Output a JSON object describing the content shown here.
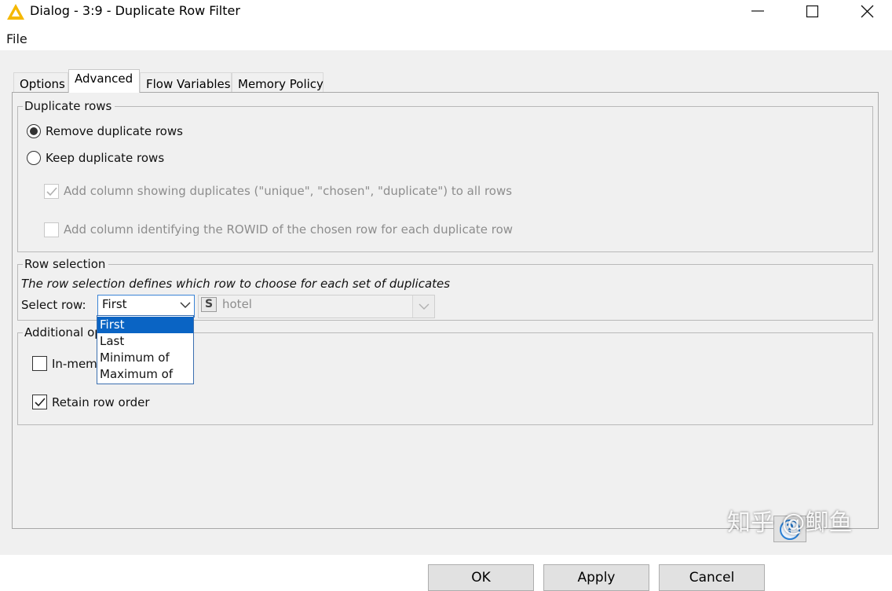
{
  "window": {
    "title": "Dialog - 3:9 - Duplicate Row Filter",
    "icons": {
      "app": "warning-triangle-icon",
      "minimize": "minimize-icon",
      "maximize": "maximize-icon",
      "close": "close-icon"
    }
  },
  "menu": {
    "file": "File"
  },
  "tabs": [
    {
      "label": "Options",
      "active": false
    },
    {
      "label": "Advanced",
      "active": true
    },
    {
      "label": "Flow Variables",
      "active": false
    },
    {
      "label": "Memory Policy",
      "active": false
    }
  ],
  "duplicate_rows": {
    "title": "Duplicate rows",
    "remove_label": "Remove duplicate rows",
    "remove_checked": true,
    "keep_label": "Keep duplicate rows",
    "keep_checked": false,
    "add_column_label": "Add column showing duplicates (\"unique\", \"chosen\", \"duplicate\") to all rows",
    "add_column_checked": true,
    "add_rowid_label": "Add column identifying the ROWID of the chosen row for each duplicate row",
    "add_rowid_checked": false
  },
  "row_selection": {
    "title": "Row selection",
    "description": "The row selection defines which row to choose for each set of duplicates",
    "select_label": "Select row:",
    "select_value": "First",
    "column_type_badge": "S",
    "column_value": "hotel",
    "options": [
      "First",
      "Last",
      "Minimum of",
      "Maximum of"
    ]
  },
  "additional_options": {
    "title": "Additional op",
    "in_memory_label": "In-memo",
    "in_memory_checked": false,
    "retain_order_label": "Retain row order",
    "retain_order_checked": true
  },
  "buttons": {
    "ok": "OK",
    "apply": "Apply",
    "cancel": "Cancel",
    "help": "?"
  },
  "watermark": "知乎 @鲫鱼",
  "colors": {
    "accent": "#0a64c4",
    "focus_border": "#3b84d6",
    "app_icon": "#f5b800",
    "help_icon": "#2a7fd4"
  }
}
